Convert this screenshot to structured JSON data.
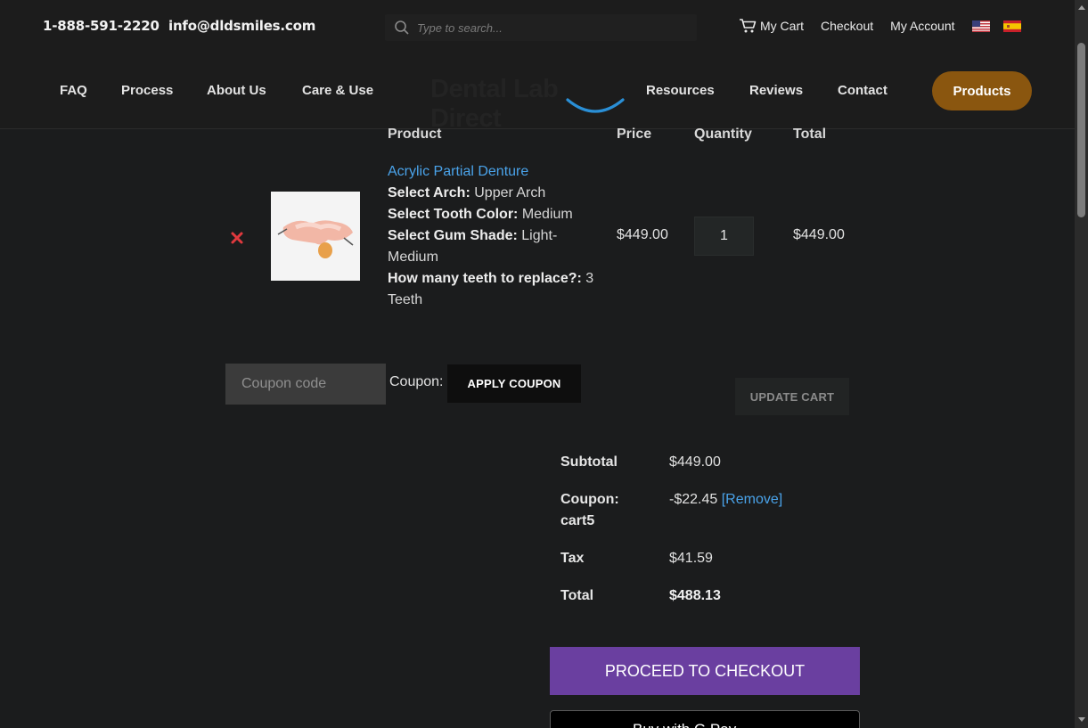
{
  "topbar": {
    "phone": "1-888-591-2220",
    "email": "info@dldsmiles.com",
    "search_placeholder": "Type to search...",
    "links": {
      "cart": "My Cart",
      "checkout": "Checkout",
      "account": "My Account"
    }
  },
  "nav": {
    "items": [
      "FAQ",
      "Process",
      "About Us",
      "Care & Use",
      "Resources",
      "Reviews",
      "Contact"
    ],
    "logo_text": "Dental Lab Direct",
    "products": "Products"
  },
  "cart": {
    "headers": {
      "product": "Product",
      "price": "Price",
      "quantity": "Quantity",
      "total": "Total"
    },
    "item": {
      "name": "Acrylic Partial Denture",
      "options": [
        {
          "label": "Select Arch:",
          "value": "Upper Arch"
        },
        {
          "label": "Select Tooth Color:",
          "value": "Medium"
        },
        {
          "label": "Select Gum Shade:",
          "value": "Light-Medium"
        },
        {
          "label": "How many teeth to replace?:",
          "value": "3 Teeth"
        }
      ],
      "price": "$449.00",
      "quantity": "1",
      "total": "$449.00"
    },
    "coupon": {
      "placeholder": "Coupon code",
      "label": "Coupon:",
      "apply": "APPLY COUPON",
      "update": "UPDATE CART"
    }
  },
  "totals": {
    "subtotal_label": "Subtotal",
    "subtotal": "$449.00",
    "coupon_label": "Coupon:",
    "coupon_code": "cart5",
    "coupon_value": "-$22.45",
    "coupon_remove": "[Remove]",
    "tax_label": "Tax",
    "tax": "$41.59",
    "total_label": "Total",
    "total": "$488.13",
    "checkout": "PROCEED TO CHECKOUT",
    "gpay": "Buy with G Pay"
  },
  "colors": {
    "accent_products": "#8a560f",
    "checkout": "#6a3fa0",
    "link": "#4aa3ea",
    "remove": "#e0393e"
  }
}
